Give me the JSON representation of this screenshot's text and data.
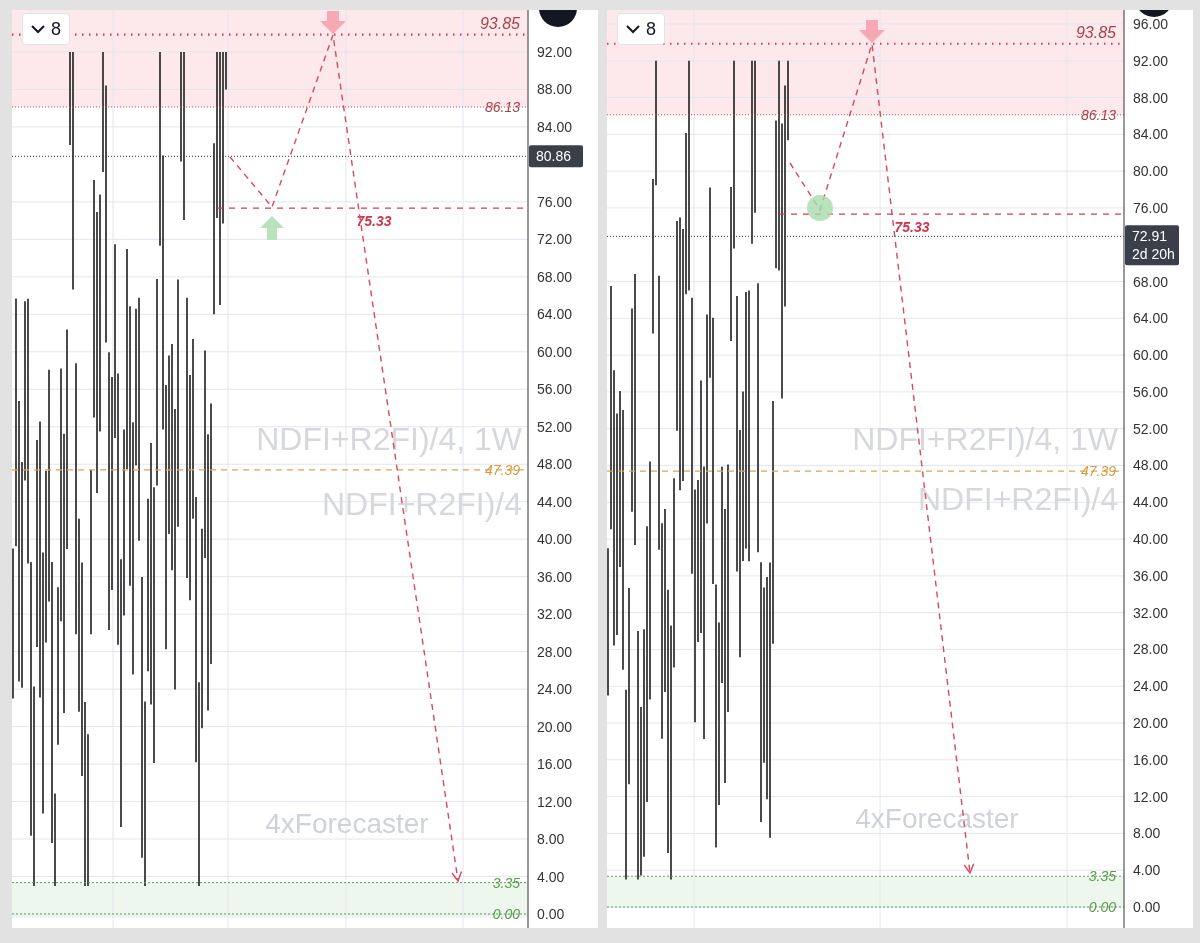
{
  "panels": [
    {
      "interval_button": {
        "label": "8"
      },
      "price_scale": [
        "92.00",
        "88.00",
        "84.00",
        "76.00",
        "72.00",
        "68.00",
        "64.00",
        "60.00",
        "56.00",
        "52.00",
        "48.00",
        "44.00",
        "40.00",
        "36.00",
        "32.00",
        "28.00",
        "24.00",
        "20.00",
        "16.00",
        "12.00",
        "8.00",
        "4.00",
        "0.00"
      ],
      "levels": [
        {
          "kind": "target",
          "label": "93.85"
        },
        {
          "kind": "zone_edge",
          "label": "86.13"
        },
        {
          "kind": "entry",
          "label": "75.33"
        },
        {
          "kind": "midline",
          "label": "47.39"
        },
        {
          "kind": "floor",
          "label": "3.35"
        },
        {
          "kind": "floor",
          "label": "0.00"
        }
      ],
      "last_price": {
        "label": "80.86"
      },
      "pivot_marker": {
        "kind": "arrow"
      },
      "symbol_watermark": [
        "NDFI+R2FI)/4, 1W",
        "NDFI+R2FI)/4"
      ],
      "author_watermark": "4xForecaster"
    },
    {
      "interval_button": {
        "label": "8"
      },
      "price_scale": [
        "96.00",
        "92.00",
        "88.00",
        "84.00",
        "80.00",
        "76.00",
        "68.00",
        "64.00",
        "60.00",
        "56.00",
        "52.00",
        "48.00",
        "44.00",
        "40.00",
        "36.00",
        "32.00",
        "28.00",
        "24.00",
        "20.00",
        "16.00",
        "12.00",
        "8.00",
        "4.00",
        "0.00"
      ],
      "levels": [
        {
          "kind": "target",
          "label": "93.85"
        },
        {
          "kind": "zone_edge",
          "label": "86.13"
        },
        {
          "kind": "entry",
          "label": "75.33"
        },
        {
          "kind": "midline",
          "label": "47.39"
        },
        {
          "kind": "floor",
          "label": "3.35"
        },
        {
          "kind": "floor",
          "label": "0.00"
        }
      ],
      "last_price": {
        "label": "72.91",
        "countdown": "2d 20h"
      },
      "pivot_marker": {
        "kind": "circle"
      },
      "symbol_watermark": [
        "NDFI+R2FI)/4, 1W",
        "NDFI+R2FI)/4"
      ],
      "author_watermark": "4xForecaster"
    }
  ]
}
